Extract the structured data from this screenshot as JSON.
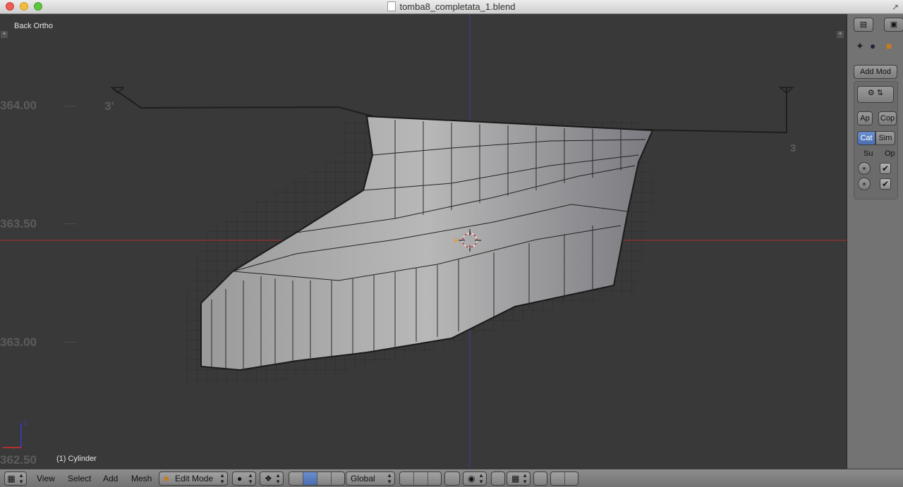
{
  "window": {
    "title": "tomba8_completata_1.blend"
  },
  "viewport": {
    "view_label": "Back Ortho",
    "object_label": "(1) Cylinder",
    "ruler_labels": [
      "364.00",
      "363.50",
      "363.00",
      "362.50"
    ],
    "section_markers": [
      "3'",
      "3"
    ],
    "axis_gizmo_label": "Z",
    "colors": {
      "x_axis": "#b03030",
      "z_axis": "#3c3c9e",
      "background": "#393939"
    }
  },
  "properties_panel": {
    "add_modifier_label": "Add Mod",
    "apply_label": "Ap",
    "copy_label": "Cop",
    "catmull_label": "Cat",
    "simple_label": "Sim",
    "col_subdiv_label": "Su",
    "col_options_label": "Op",
    "options_checked": [
      true,
      true
    ]
  },
  "header": {
    "menus": [
      "View",
      "Select",
      "Add",
      "Mesh"
    ],
    "mode": "Edit Mode",
    "orientation": "Global"
  }
}
